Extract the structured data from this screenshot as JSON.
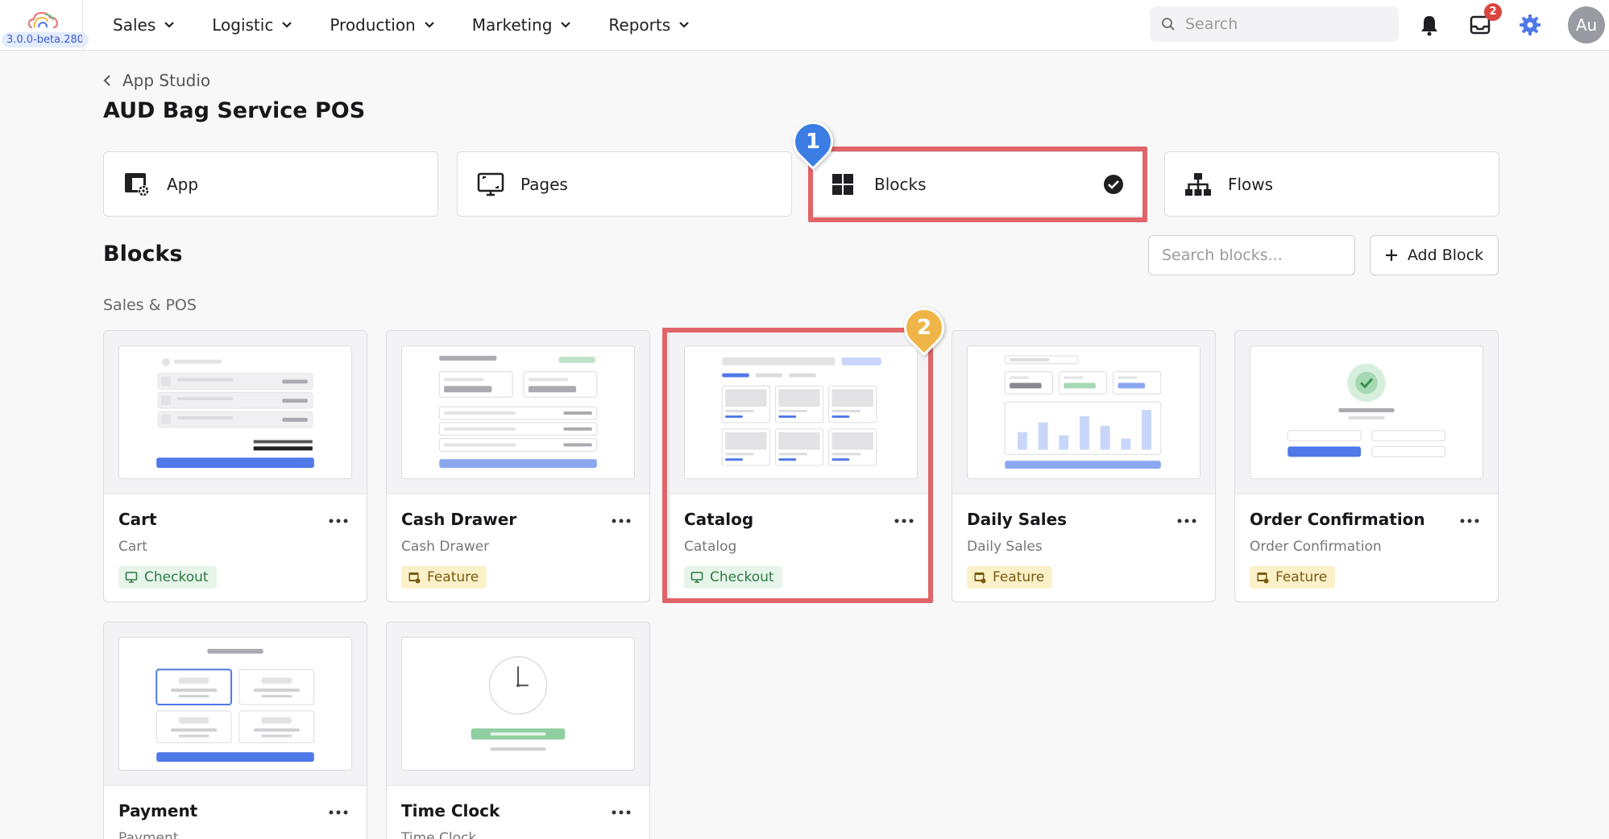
{
  "app": {
    "version": "3.0.0-beta.280"
  },
  "nav": {
    "items": [
      "Sales",
      "Logistic",
      "Production",
      "Marketing",
      "Reports"
    ],
    "search_placeholder": "Search",
    "inbox_badge": "2",
    "avatar_initials": "Au"
  },
  "header": {
    "breadcrumb": "App Studio",
    "title": "AUD Bag Service POS"
  },
  "tabs": [
    {
      "label": "App"
    },
    {
      "label": "Pages"
    },
    {
      "label": "Blocks"
    },
    {
      "label": "Flows"
    }
  ],
  "blocks": {
    "title": "Blocks",
    "search_placeholder": "Search blocks...",
    "add_label": "Add Block",
    "group_label": "Sales & POS",
    "items": [
      {
        "name": "Cart",
        "subtitle": "Cart",
        "tag": "Checkout"
      },
      {
        "name": "Cash Drawer",
        "subtitle": "Cash Drawer",
        "tag": "Feature"
      },
      {
        "name": "Catalog",
        "subtitle": "Catalog",
        "tag": "Checkout"
      },
      {
        "name": "Daily Sales",
        "subtitle": "Daily Sales",
        "tag": "Feature"
      },
      {
        "name": "Order Confirmation",
        "subtitle": "Order Confirmation",
        "tag": "Feature"
      },
      {
        "name": "Payment",
        "subtitle": "Payment"
      },
      {
        "name": "Time Clock",
        "subtitle": "Time Clock"
      }
    ]
  },
  "annotations": {
    "marker_1": "1",
    "marker_2": "2",
    "highlight_color": "#e06468",
    "marker_1_color": "#3b7de3",
    "marker_2_color": "#f0b548"
  },
  "colors": {
    "accent": "#4f78e8",
    "checkout_tag_bg": "#e6f4ea",
    "feature_tag_bg": "#fbf1c9"
  }
}
